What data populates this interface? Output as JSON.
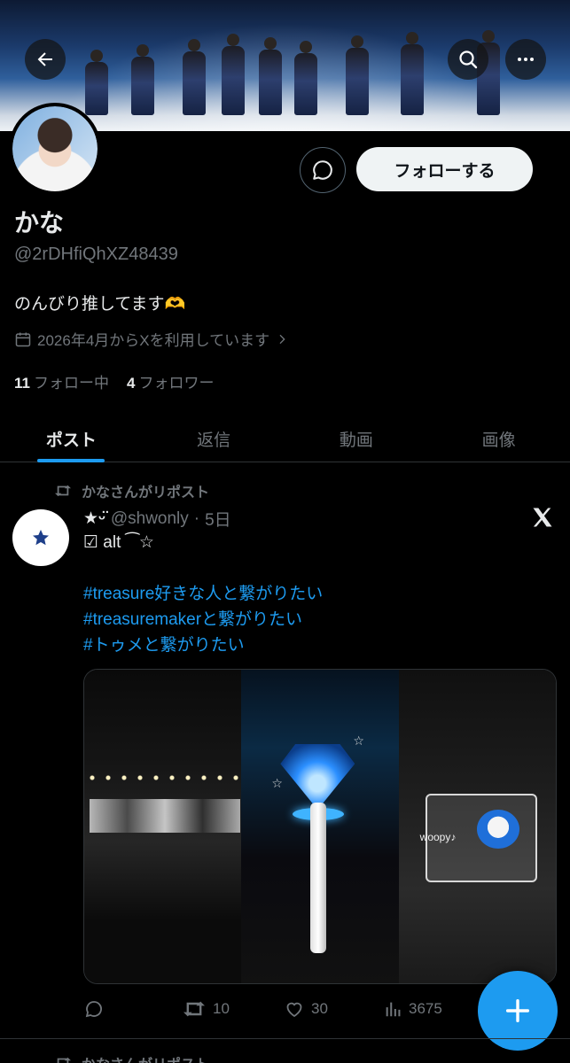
{
  "header": {
    "back_icon": "arrow-left-icon",
    "search_icon": "search-icon",
    "more_icon": "more-horizontal-icon"
  },
  "profile": {
    "name": "かな",
    "handle": "@2rDHfiQhXZ48439",
    "bio": "のんびり推してます🫶",
    "joined": "2026年4月からXを利用しています",
    "following_count": "11",
    "following_label": "フォロー中",
    "followers_count": "4",
    "followers_label": "フォロワー",
    "follow_button": "フォローする"
  },
  "tabs": [
    {
      "label": "ポスト",
      "active": true
    },
    {
      "label": "返信",
      "active": false
    },
    {
      "label": "動画",
      "active": false
    },
    {
      "label": "画像",
      "active": false
    }
  ],
  "post": {
    "repost_label": "かなさんがリポスト",
    "author_name": "★ᵕ̈",
    "author_handle": "@shwonly",
    "time": "5日",
    "line2": "☑ alt ⁀☆",
    "hashtags": [
      "#treasure好きな人と繋がりたい",
      "#treasuremakerと繋がりたい",
      "#トゥメと繋がりたい"
    ],
    "media_caption": "woopy♪",
    "replies": "",
    "reposts": "10",
    "likes": "30",
    "views": "3675"
  },
  "next_post": {
    "repost_label": "かなさんがリポスト"
  },
  "colors": {
    "accent": "#1d9bf0",
    "background": "#000000",
    "muted": "#71767b"
  }
}
